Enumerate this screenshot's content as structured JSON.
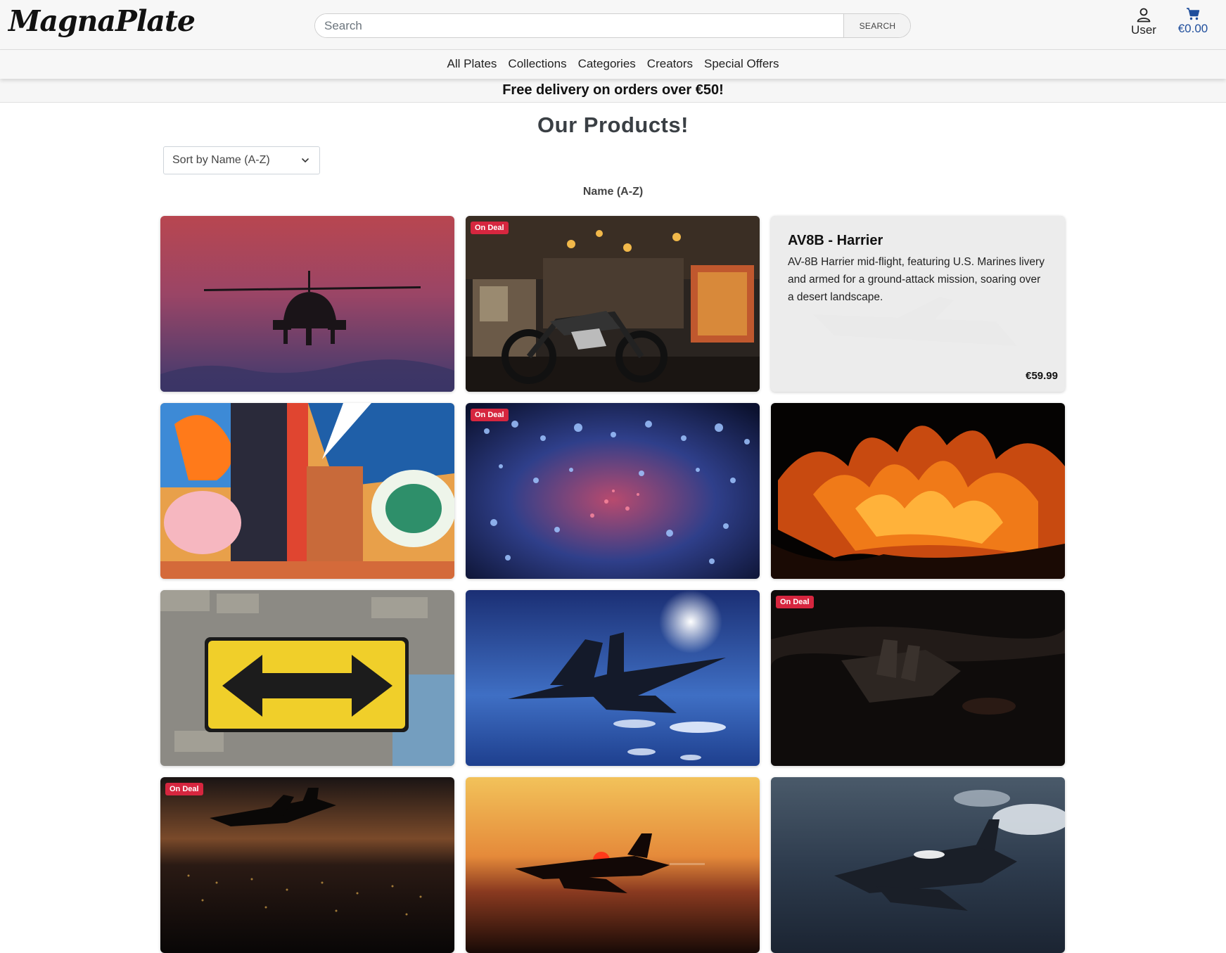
{
  "header": {
    "logo": "MagnaPlate",
    "search_placeholder": "Search",
    "search_button": "SEARCH",
    "user_label": "User",
    "cart_total": "€0.00"
  },
  "nav": {
    "items": [
      "All Plates",
      "Collections",
      "Categories",
      "Creators",
      "Special Offers"
    ]
  },
  "promo": "Free delivery on orders over €50!",
  "page_title": "Our Products!",
  "sort": {
    "selected": "Sort by Name (A-Z)",
    "caption": "Name (A-Z)"
  },
  "products": [
    {
      "image": "apache-helicopter-sunset",
      "deal": false
    },
    {
      "image": "motorcycle-in-antique-shop",
      "deal": true
    },
    {
      "image": "av8b-harrier",
      "deal": false,
      "title": "AV8B - Harrier",
      "description": "AV-8B Harrier mid-flight, featuring U.S. Marines livery and armed for a ground-attack mission, soaring over a desert landscape.",
      "price": "€59.99"
    },
    {
      "image": "graffiti-wall",
      "deal": false
    },
    {
      "image": "lantern-installation",
      "deal": true
    },
    {
      "image": "fire-flames",
      "deal": false
    },
    {
      "image": "yellow-arrow-sign",
      "deal": false
    },
    {
      "image": "jet-above-clouds",
      "deal": false
    },
    {
      "image": "jet-at-night",
      "deal": true
    },
    {
      "image": "jet-over-city-dusk",
      "deal": true
    },
    {
      "image": "jet-at-sunset",
      "deal": false
    },
    {
      "image": "f16-over-clouds",
      "deal": false
    }
  ],
  "labels": {
    "deal_badge": "On Deal"
  },
  "colors": {
    "deal_badge": "#d6263f",
    "cart_accent": "#1f4e9c"
  }
}
